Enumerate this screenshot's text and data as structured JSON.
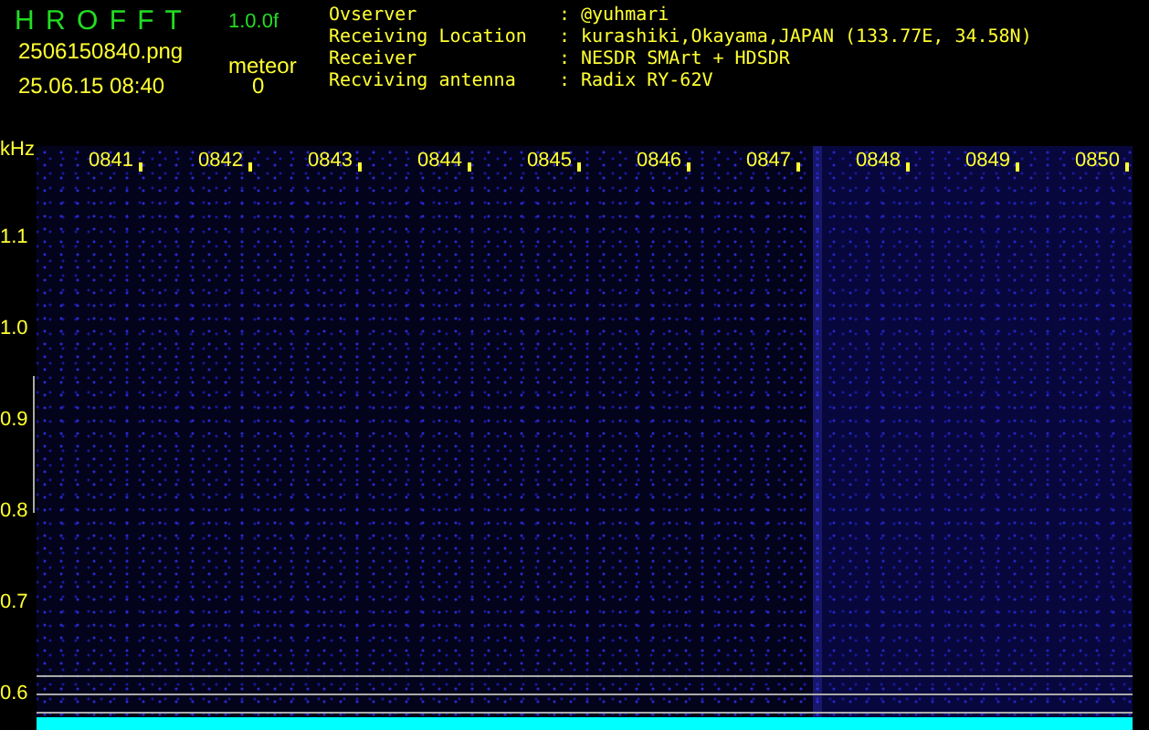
{
  "app": {
    "title": "H R O F F T",
    "version": "1.0.0f",
    "filename": "2506150840.png",
    "timestamp": "25.06.15 08:40",
    "meteor_label": "meteor",
    "meteor_count": "0"
  },
  "info": [
    {
      "label": "Ovserver",
      "separator": ":",
      "value": "@yuhmari"
    },
    {
      "label": "Receiving Location",
      "separator": ":",
      "value": "kurashiki,Okayama,JAPAN (133.77E, 34.58N)"
    },
    {
      "label": "Receiver",
      "separator": ":",
      "value": "NESDR SMArt + HDSDR"
    },
    {
      "label": "Recviving antenna",
      "separator": ":",
      "value": "Radix RY-62V"
    }
  ],
  "plot": {
    "y_unit": "kHz",
    "y_labels": [
      "1.1",
      "1.0",
      "0.9",
      "0.8",
      "0.7",
      "0.6"
    ],
    "time_labels": [
      "0841",
      "0842",
      "0843",
      "0844",
      "0845",
      "0846",
      "0847",
      "0848",
      "0849",
      "0850"
    ]
  }
}
